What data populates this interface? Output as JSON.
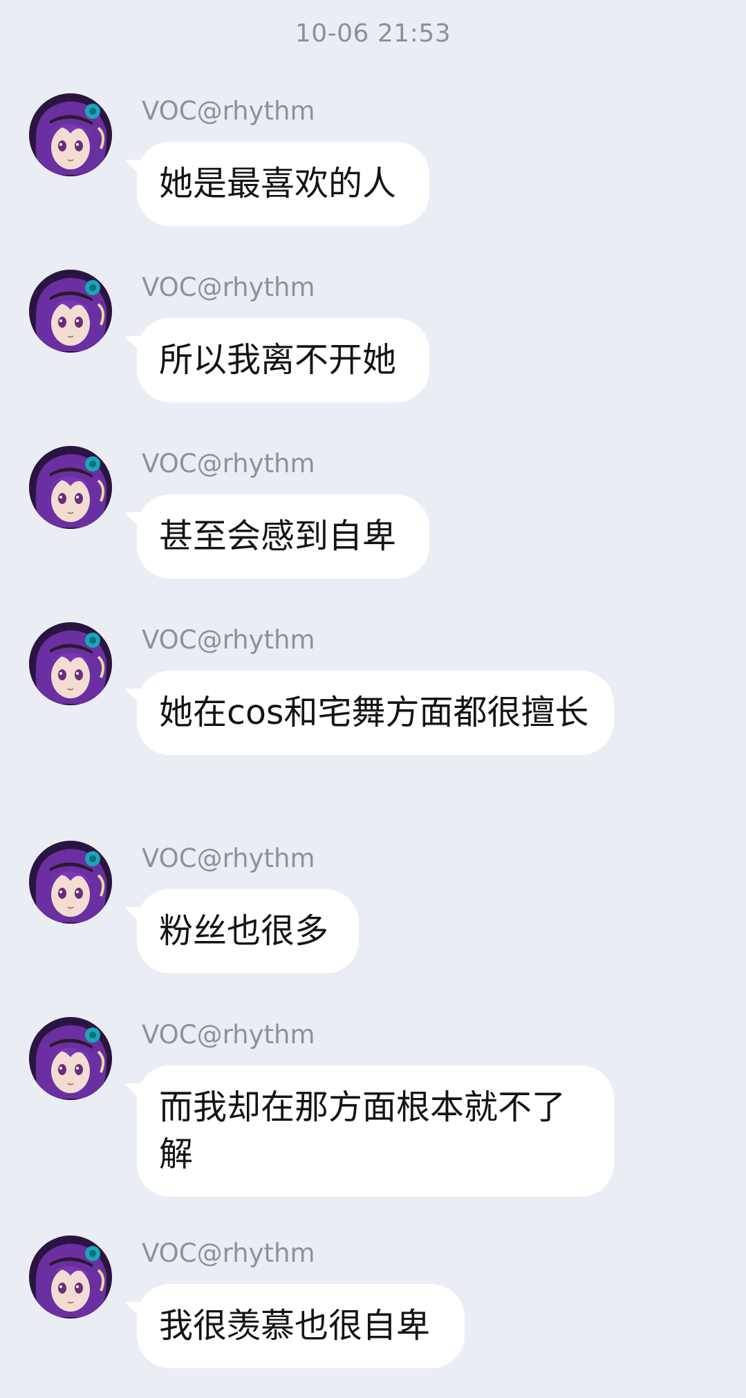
{
  "timestamp": "10-06 21:53",
  "colors": {
    "background": "#eaedf4",
    "bubble": "#ffffff",
    "sender_text": "#8e919a",
    "message_text": "#141414",
    "avatar_hair": "#6a2fa0",
    "avatar_flower": "#1aa6b8"
  },
  "messages": [
    {
      "sender": "VOC@rhythm",
      "text": "她是最喜欢的人",
      "avatar_icon": "anime-avatar-icon"
    },
    {
      "sender": "VOC@rhythm",
      "text": "所以我离不开她",
      "avatar_icon": "anime-avatar-icon"
    },
    {
      "sender": "VOC@rhythm",
      "text": "甚至会感到自卑",
      "avatar_icon": "anime-avatar-icon"
    },
    {
      "sender": "VOC@rhythm",
      "text": "她在cos和宅舞方面都很擅长",
      "avatar_icon": "anime-avatar-icon"
    },
    {
      "sender": "VOC@rhythm",
      "text": "粉丝也很多",
      "avatar_icon": "anime-avatar-icon"
    },
    {
      "sender": "VOC@rhythm",
      "text": "而我却在那方面根本就不了解",
      "avatar_icon": "anime-avatar-icon"
    },
    {
      "sender": "VOC@rhythm",
      "text": "我很羡慕也很自卑",
      "avatar_icon": "anime-avatar-icon"
    }
  ]
}
